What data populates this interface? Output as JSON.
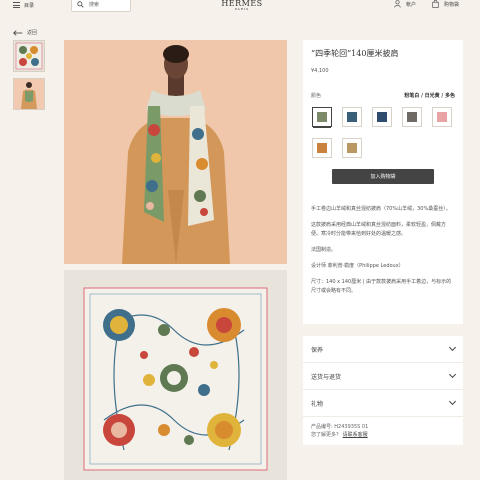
{
  "header": {
    "menu_label": "目录",
    "search_placeholder": "搜索",
    "brand": "HERMES",
    "brand_city": "PARIS",
    "account_label": "帐户",
    "bag_label": "购物袋"
  },
  "nav": {
    "back_label": "返回"
  },
  "product": {
    "title": "“四季轮回”140厘米披肩",
    "price": "¥4,100",
    "colour_label": "颜色",
    "colour_value": "粉笔白 / 日光黄 / 多色",
    "swatches": [
      {
        "name": "swatch-1",
        "color": "#7d8a6a",
        "selected": true
      },
      {
        "name": "swatch-2",
        "color": "#3a5f7b",
        "selected": false
      },
      {
        "name": "swatch-3",
        "color": "#2f4b6e",
        "selected": false
      },
      {
        "name": "swatch-4",
        "color": "#6f6a63",
        "selected": false
      },
      {
        "name": "swatch-5",
        "color": "#e9a3a6",
        "selected": false
      },
      {
        "name": "swatch-6",
        "color": "#c9823e",
        "selected": false
      },
      {
        "name": "swatch-7",
        "color": "#b99864",
        "selected": false
      }
    ],
    "add_to_bag": "加入购物袋",
    "description": [
      "手工卷边山羊绒和真丝混纺披肩（70%山羊绒，30%桑蚕丝）。",
      "这款披肩采用经典山羊绒和真丝混纺面料，柔软轻盈，佩戴方便。寒冷时分能带来恰到好处的温暖之感。",
      "法国制造。",
      "设计师 菲利普·勒度（Philippe Ledoux）",
      "尺寸：140 x 140厘米 | 由于款款披肩采用手工着边，与标示的尺寸或会略有不同。"
    ]
  },
  "accordion": [
    {
      "label": "保养"
    },
    {
      "label": "送货与退货"
    },
    {
      "label": "礼物"
    }
  ],
  "meta": {
    "product_code_label": "产品编号:",
    "product_code": "H243935S 01",
    "help_text": "您了解更多？",
    "contact_link": "请联系客服"
  }
}
